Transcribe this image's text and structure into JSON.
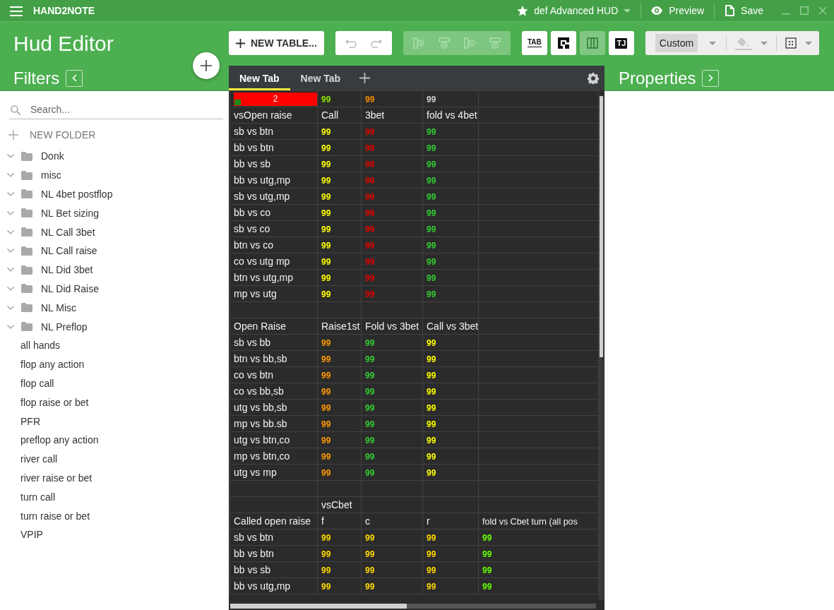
{
  "titlebar": {
    "app_name": "HAND2NOTE",
    "hud_name": "def Advanced HUD",
    "actions": [
      {
        "kind": "preview",
        "label": "Preview"
      },
      {
        "kind": "save",
        "label": "Save"
      }
    ]
  },
  "editor_title": "Hud Editor",
  "filters": {
    "title": "Filters",
    "search": {
      "placeholder": "Search..."
    },
    "new_folder": "NEW FOLDER",
    "tree": [
      {
        "label": "Donk"
      },
      {
        "label": "misc"
      },
      {
        "label": "NL 4bet postflop"
      },
      {
        "label": "NL Bet sizing"
      },
      {
        "label": "NL Call 3bet"
      },
      {
        "label": "NL Call raise"
      },
      {
        "label": "NL Did 3bet"
      },
      {
        "label": "NL Did Raise"
      },
      {
        "label": "NL Misc"
      },
      {
        "label": "NL Preflop",
        "children": [
          {
            "label": "all hands"
          },
          {
            "label": "flop any action"
          },
          {
            "label": "flop call"
          },
          {
            "label": "flop raise or bet"
          },
          {
            "label": "PFR"
          },
          {
            "label": "preflop any action"
          },
          {
            "label": "river call"
          },
          {
            "label": "river raise or bet"
          },
          {
            "label": "turn call"
          },
          {
            "label": "turn raise or bet"
          },
          {
            "label": "VPIP"
          }
        ]
      }
    ]
  },
  "toolbar": {
    "new_table": "NEW TABLE...",
    "history_tools": [
      {
        "kind": "undo",
        "disabled": true
      },
      {
        "kind": "redo",
        "disabled": true
      }
    ],
    "edit_tools": [
      {
        "kind": "insert-column",
        "disabled": true
      },
      {
        "kind": "insert-row",
        "disabled": true
      },
      {
        "kind": "remove-column",
        "disabled": true
      },
      {
        "kind": "remove-row",
        "disabled": true
      }
    ],
    "view_tools": [
      {
        "kind": "text",
        "label": "TAB",
        "selected": false
      },
      {
        "kind": "grid",
        "selected": false
      },
      {
        "kind": "columns",
        "selected": true
      },
      {
        "kind": "text",
        "label": "TJ",
        "selected": false
      }
    ],
    "style_select": {
      "value": "Custom"
    },
    "fill_tool": {
      "disabled": true
    }
  },
  "tabs": [
    {
      "label": "New Tab",
      "selected": true
    },
    {
      "label": "New Tab",
      "selected": false
    }
  ],
  "table": {
    "rows": [
      {
        "cells": [
          {
            "kind": "bar",
            "text": "2",
            "color": "#ff0000"
          },
          {
            "kind": "value",
            "text": "99",
            "color": "#8ee000"
          },
          {
            "kind": "value",
            "text": "99",
            "color": "#f08c00"
          },
          {
            "kind": "value",
            "text": "99",
            "color": "#cccccc"
          },
          {
            "kind": "empty"
          }
        ]
      },
      {
        "cells": [
          {
            "kind": "label",
            "text": "vsOpen raise"
          },
          {
            "kind": "label",
            "text": "Call"
          },
          {
            "kind": "label",
            "text": "3bet"
          },
          {
            "kind": "label",
            "text": "fold vs 4bet"
          },
          {
            "kind": "empty"
          }
        ]
      },
      {
        "cells": [
          {
            "kind": "label",
            "text": "sb vs btn"
          },
          {
            "kind": "value",
            "text": "99",
            "color": "#ffff00"
          },
          {
            "kind": "value",
            "text": "99",
            "color": "#e00000"
          },
          {
            "kind": "value",
            "text": "99",
            "color": "#33cc33"
          },
          {
            "kind": "empty"
          }
        ]
      },
      {
        "cells": [
          {
            "kind": "label",
            "text": "bb vs btn"
          },
          {
            "kind": "value",
            "text": "99",
            "color": "#ffff00"
          },
          {
            "kind": "value",
            "text": "99",
            "color": "#e00000"
          },
          {
            "kind": "value",
            "text": "99",
            "color": "#33cc33"
          },
          {
            "kind": "empty"
          }
        ]
      },
      {
        "cells": [
          {
            "kind": "label",
            "text": "bb vs sb"
          },
          {
            "kind": "value",
            "text": "99",
            "color": "#ffff00"
          },
          {
            "kind": "value",
            "text": "99",
            "color": "#e00000"
          },
          {
            "kind": "value",
            "text": "99",
            "color": "#33cc33"
          },
          {
            "kind": "empty"
          }
        ]
      },
      {
        "cells": [
          {
            "kind": "label",
            "text": "bb vs utg,mp"
          },
          {
            "kind": "value",
            "text": "99",
            "color": "#ffff00"
          },
          {
            "kind": "value",
            "text": "99",
            "color": "#e00000"
          },
          {
            "kind": "value",
            "text": "99",
            "color": "#33cc33"
          },
          {
            "kind": "empty"
          }
        ]
      },
      {
        "cells": [
          {
            "kind": "label",
            "text": "sb  vs utg,mp"
          },
          {
            "kind": "value",
            "text": "99",
            "color": "#ffff00"
          },
          {
            "kind": "value",
            "text": "99",
            "color": "#e00000"
          },
          {
            "kind": "value",
            "text": "99",
            "color": "#33cc33"
          },
          {
            "kind": "empty"
          }
        ]
      },
      {
        "cells": [
          {
            "kind": "label",
            "text": "bb vs co"
          },
          {
            "kind": "value",
            "text": "99",
            "color": "#ffff00"
          },
          {
            "kind": "value",
            "text": "99",
            "color": "#e00000"
          },
          {
            "kind": "value",
            "text": "99",
            "color": "#33cc33"
          },
          {
            "kind": "empty"
          }
        ]
      },
      {
        "cells": [
          {
            "kind": "label",
            "text": "sb vs co"
          },
          {
            "kind": "value",
            "text": "99",
            "color": "#ffff00"
          },
          {
            "kind": "value",
            "text": "99",
            "color": "#e00000"
          },
          {
            "kind": "value",
            "text": "99",
            "color": "#33cc33"
          },
          {
            "kind": "empty"
          }
        ]
      },
      {
        "cells": [
          {
            "kind": "label",
            "text": "btn vs co"
          },
          {
            "kind": "value",
            "text": "99",
            "color": "#ffff00"
          },
          {
            "kind": "value",
            "text": "99",
            "color": "#e00000"
          },
          {
            "kind": "value",
            "text": "99",
            "color": "#33cc33"
          },
          {
            "kind": "empty"
          }
        ]
      },
      {
        "cells": [
          {
            "kind": "label",
            "text": "co vs utg mp"
          },
          {
            "kind": "value",
            "text": "99",
            "color": "#ffff00"
          },
          {
            "kind": "value",
            "text": "99",
            "color": "#e00000"
          },
          {
            "kind": "value",
            "text": "99",
            "color": "#33cc33"
          },
          {
            "kind": "empty"
          }
        ]
      },
      {
        "cells": [
          {
            "kind": "label",
            "text": "btn vs utg,mp"
          },
          {
            "kind": "value",
            "text": "99",
            "color": "#ffff00"
          },
          {
            "kind": "value",
            "text": "99",
            "color": "#e00000"
          },
          {
            "kind": "value",
            "text": "99",
            "color": "#33cc33"
          },
          {
            "kind": "empty"
          }
        ]
      },
      {
        "cells": [
          {
            "kind": "label",
            "text": "mp vs utg"
          },
          {
            "kind": "value",
            "text": "99",
            "color": "#ffff00"
          },
          {
            "kind": "value",
            "text": "99",
            "color": "#e00000"
          },
          {
            "kind": "value",
            "text": "99",
            "color": "#33cc33"
          },
          {
            "kind": "empty"
          }
        ]
      },
      {
        "cells": [
          {
            "kind": "empty"
          },
          {
            "kind": "empty"
          },
          {
            "kind": "empty"
          },
          {
            "kind": "empty"
          },
          {
            "kind": "empty"
          }
        ]
      },
      {
        "cells": [
          {
            "kind": "label",
            "text": "Open Raise"
          },
          {
            "kind": "label",
            "text": "Raise1st"
          },
          {
            "kind": "label",
            "text": "Fold vs 3bet"
          },
          {
            "kind": "label",
            "text": "Call vs 3bet"
          },
          {
            "kind": "empty"
          }
        ]
      },
      {
        "cells": [
          {
            "kind": "label",
            "text": "sb vs bb"
          },
          {
            "kind": "value",
            "text": "99",
            "color": "#ff9900"
          },
          {
            "kind": "value",
            "text": "99",
            "color": "#33cc33"
          },
          {
            "kind": "value",
            "text": "99",
            "color": "#ffff00"
          },
          {
            "kind": "empty"
          }
        ]
      },
      {
        "cells": [
          {
            "kind": "label",
            "text": "btn vs bb,sb"
          },
          {
            "kind": "value",
            "text": "99",
            "color": "#ff9900"
          },
          {
            "kind": "value",
            "text": "99",
            "color": "#33cc33"
          },
          {
            "kind": "value",
            "text": "99",
            "color": "#ffff00"
          },
          {
            "kind": "empty"
          }
        ]
      },
      {
        "cells": [
          {
            "kind": "label",
            "text": "co vs btn"
          },
          {
            "kind": "value",
            "text": "99",
            "color": "#ff9900"
          },
          {
            "kind": "value",
            "text": "99",
            "color": "#33cc33"
          },
          {
            "kind": "value",
            "text": "99",
            "color": "#ffff00"
          },
          {
            "kind": "empty"
          }
        ]
      },
      {
        "cells": [
          {
            "kind": "label",
            "text": "co vs bb,sb"
          },
          {
            "kind": "value",
            "text": "99",
            "color": "#ff9900"
          },
          {
            "kind": "value",
            "text": "99",
            "color": "#33cc33"
          },
          {
            "kind": "value",
            "text": "99",
            "color": "#ffff00"
          },
          {
            "kind": "empty"
          }
        ]
      },
      {
        "cells": [
          {
            "kind": "label",
            "text": "utg vs bb,sb"
          },
          {
            "kind": "value",
            "text": "99",
            "color": "#ff9900"
          },
          {
            "kind": "value",
            "text": "99",
            "color": "#33cc33"
          },
          {
            "kind": "value",
            "text": "99",
            "color": "#ffff00"
          },
          {
            "kind": "empty"
          }
        ]
      },
      {
        "cells": [
          {
            "kind": "label",
            "text": "mp vs bb.sb"
          },
          {
            "kind": "value",
            "text": "99",
            "color": "#ff9900"
          },
          {
            "kind": "value",
            "text": "99",
            "color": "#33cc33"
          },
          {
            "kind": "value",
            "text": "99",
            "color": "#ffff00"
          },
          {
            "kind": "empty"
          }
        ]
      },
      {
        "cells": [
          {
            "kind": "label",
            "text": "utg vs btn,co"
          },
          {
            "kind": "value",
            "text": "99",
            "color": "#ff9900"
          },
          {
            "kind": "value",
            "text": "99",
            "color": "#33cc33"
          },
          {
            "kind": "value",
            "text": "99",
            "color": "#ffff00"
          },
          {
            "kind": "empty"
          }
        ]
      },
      {
        "cells": [
          {
            "kind": "label",
            "text": "mp vs btn,co"
          },
          {
            "kind": "value",
            "text": "99",
            "color": "#ff9900"
          },
          {
            "kind": "value",
            "text": "99",
            "color": "#33cc33"
          },
          {
            "kind": "value",
            "text": "99",
            "color": "#ffff00"
          },
          {
            "kind": "empty"
          }
        ]
      },
      {
        "cells": [
          {
            "kind": "label",
            "text": "utg vs mp"
          },
          {
            "kind": "value",
            "text": "99",
            "color": "#ff9900"
          },
          {
            "kind": "value",
            "text": "99",
            "color": "#33cc33"
          },
          {
            "kind": "value",
            "text": "99",
            "color": "#ffff00"
          },
          {
            "kind": "empty"
          }
        ]
      },
      {
        "cells": [
          {
            "kind": "empty"
          },
          {
            "kind": "empty"
          },
          {
            "kind": "empty"
          },
          {
            "kind": "empty"
          },
          {
            "kind": "empty"
          }
        ]
      },
      {
        "cells": [
          {
            "kind": "empty"
          },
          {
            "kind": "label",
            "text": "vsCbet"
          },
          {
            "kind": "empty"
          },
          {
            "kind": "empty"
          },
          {
            "kind": "empty"
          }
        ]
      },
      {
        "cells": [
          {
            "kind": "label",
            "text": "Called open raise"
          },
          {
            "kind": "label",
            "text": "f"
          },
          {
            "kind": "label",
            "text": "c"
          },
          {
            "kind": "label",
            "text": "r"
          },
          {
            "kind": "label",
            "text": "fold vs Cbet turn  (all pos"
          }
        ]
      },
      {
        "cells": [
          {
            "kind": "label",
            "text": "sb vs btn"
          },
          {
            "kind": "value",
            "text": "99",
            "color": "#ffd700"
          },
          {
            "kind": "value",
            "text": "99",
            "color": "#ffd700"
          },
          {
            "kind": "value",
            "text": "99",
            "color": "#ffd700"
          },
          {
            "kind": "value",
            "text": "99",
            "color": "#66ff00"
          }
        ]
      },
      {
        "cells": [
          {
            "kind": "label",
            "text": "bb vs btn"
          },
          {
            "kind": "value",
            "text": "99",
            "color": "#ffd700"
          },
          {
            "kind": "value",
            "text": "99",
            "color": "#ffd700"
          },
          {
            "kind": "value",
            "text": "99",
            "color": "#ffd700"
          },
          {
            "kind": "value",
            "text": "99",
            "color": "#66ff00"
          }
        ]
      },
      {
        "cells": [
          {
            "kind": "label",
            "text": "bb vs sb"
          },
          {
            "kind": "value",
            "text": "99",
            "color": "#ffd700"
          },
          {
            "kind": "value",
            "text": "99",
            "color": "#ffd700"
          },
          {
            "kind": "value",
            "text": "99",
            "color": "#ffd700"
          },
          {
            "kind": "value",
            "text": "99",
            "color": "#66ff00"
          }
        ]
      },
      {
        "cells": [
          {
            "kind": "label",
            "text": "bb vs utg,mp"
          },
          {
            "kind": "value",
            "text": "99",
            "color": "#ffd700"
          },
          {
            "kind": "value",
            "text": "99",
            "color": "#ffd700"
          },
          {
            "kind": "value",
            "text": "99",
            "color": "#ffd700"
          },
          {
            "kind": "value",
            "text": "99",
            "color": "#66ff00"
          }
        ]
      }
    ]
  },
  "properties": {
    "title": "Properties"
  }
}
